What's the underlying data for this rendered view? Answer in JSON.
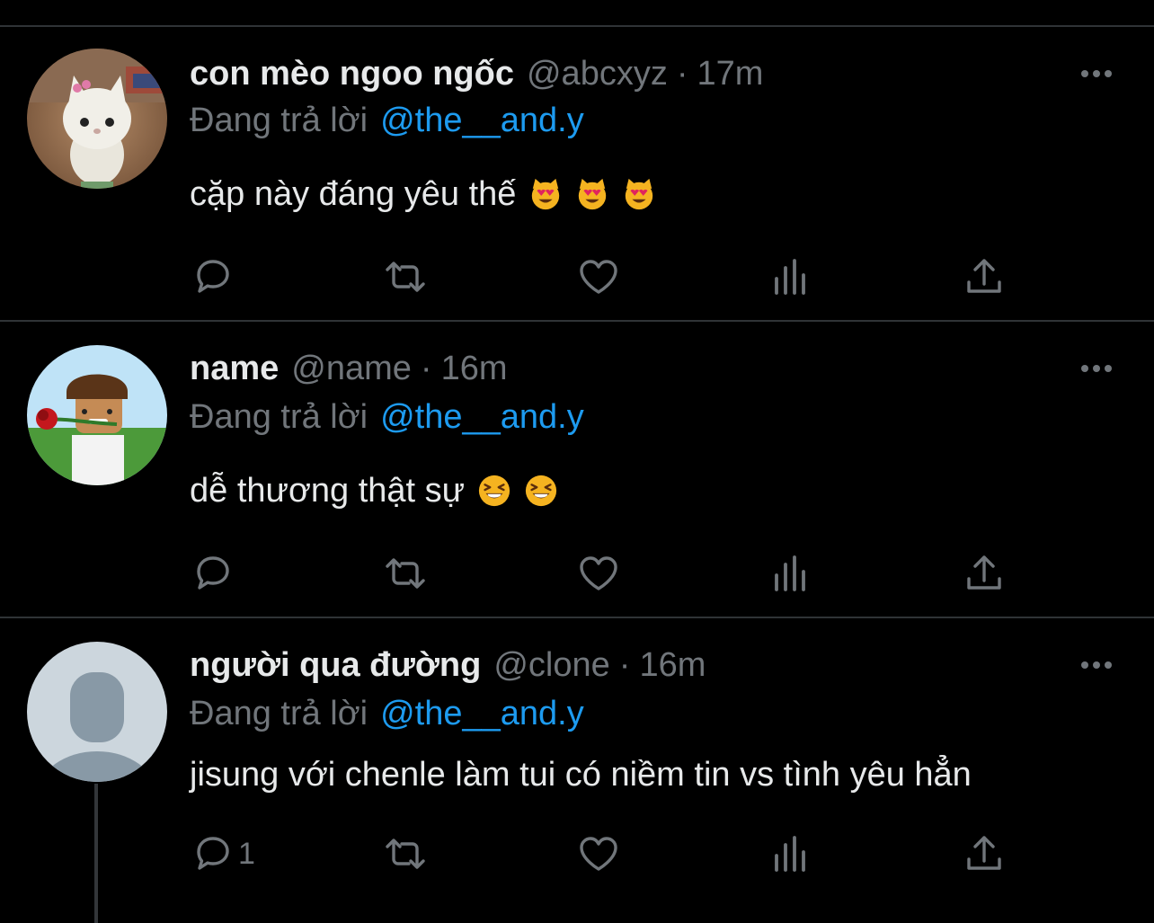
{
  "colors": {
    "background": "#000000",
    "divider": "#2f3336",
    "primary_text": "#e7e9ea",
    "secondary_text": "#71767b",
    "mention": "#1d9bf0"
  },
  "tweets": [
    {
      "display_name": "con mèo ngoo ngốc",
      "handle": "@abcxyz",
      "separator": "·",
      "time": "17m",
      "reply_prefix": "Đang trả lời",
      "reply_to": "@the__and.y",
      "text": "cặp này đáng yêu thế",
      "emojis": [
        "heart-eyes-cat-icon",
        "heart-eyes-cat-icon",
        "heart-eyes-cat-icon"
      ],
      "avatar": "white-kitten-toy-avatar",
      "reply_count": ""
    },
    {
      "display_name": "name",
      "handle": "@name",
      "separator": "·",
      "time": "16m",
      "reply_prefix": "Đang trả lời",
      "reply_to": "@the__and.y",
      "text": "dễ thương thật sự",
      "emojis": [
        "grinning-squinting-face-icon",
        "grinning-squinting-face-icon"
      ],
      "avatar": "roblox-character-rose-avatar",
      "reply_count": ""
    },
    {
      "display_name": "người qua đường",
      "handle": "@clone",
      "separator": "·",
      "time": "16m",
      "reply_prefix": "Đang trả lời",
      "reply_to": "@the__and.y",
      "text": "jisung với chenle làm tui có niềm tin vs tình yêu hẳn",
      "emojis": [],
      "avatar": "default-profile-avatar",
      "reply_count": "1"
    }
  ],
  "actions": [
    "reply-icon",
    "retweet-icon",
    "like-icon",
    "analytics-icon",
    "share-icon"
  ]
}
